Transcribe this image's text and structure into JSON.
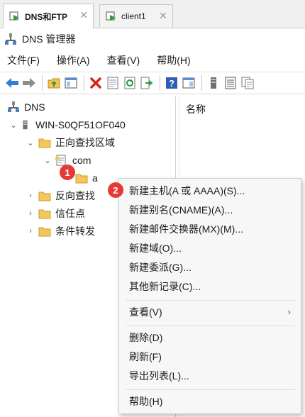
{
  "tabs": [
    {
      "label": "DNS和FTP",
      "close": "✕",
      "active": true
    },
    {
      "label": "client1",
      "close": "✕",
      "active": false
    }
  ],
  "window": {
    "title": "DNS 管理器"
  },
  "menu": {
    "file": "文件(F)",
    "action": "操作(A)",
    "view": "查看(V)",
    "help": "帮助(H)"
  },
  "toolbar": {
    "icons": [
      "back-icon",
      "forward-icon",
      "up-folder-icon",
      "show-hide-tree-icon",
      "delete-icon",
      "properties-icon",
      "refresh-icon",
      "export-icon",
      "help-icon",
      "console-icon",
      "server-icon",
      "list-icon",
      "copy-icon"
    ]
  },
  "tree": {
    "root": "DNS",
    "server": "WIN-S0QF51OF040",
    "forward_zones": "正向查找区域",
    "com": "com",
    "selected_partial": "a",
    "reverse_zones": "反向查找",
    "trust_points": "信任点",
    "conditional_forwarders": "条件转发"
  },
  "detail": {
    "column_header": "名称"
  },
  "badges": {
    "one": "1",
    "two": "2"
  },
  "context_menu": {
    "new_host": "新建主机(A 或 AAAA)(S)...",
    "new_alias": "新建别名(CNAME)(A)...",
    "new_mx": "新建邮件交换器(MX)(M)...",
    "new_domain": "新建域(O)...",
    "new_delegation": "新建委派(G)...",
    "other_records": "其他新记录(C)...",
    "view": "查看(V)",
    "view_arrow": "›",
    "delete": "删除(D)",
    "refresh": "刷新(F)",
    "export_list": "导出列表(L)...",
    "help": "帮助(H)"
  },
  "colors": {
    "badge": "#e53935",
    "folder": "#f5c65a",
    "accent_blue": "#1a6fc9"
  }
}
